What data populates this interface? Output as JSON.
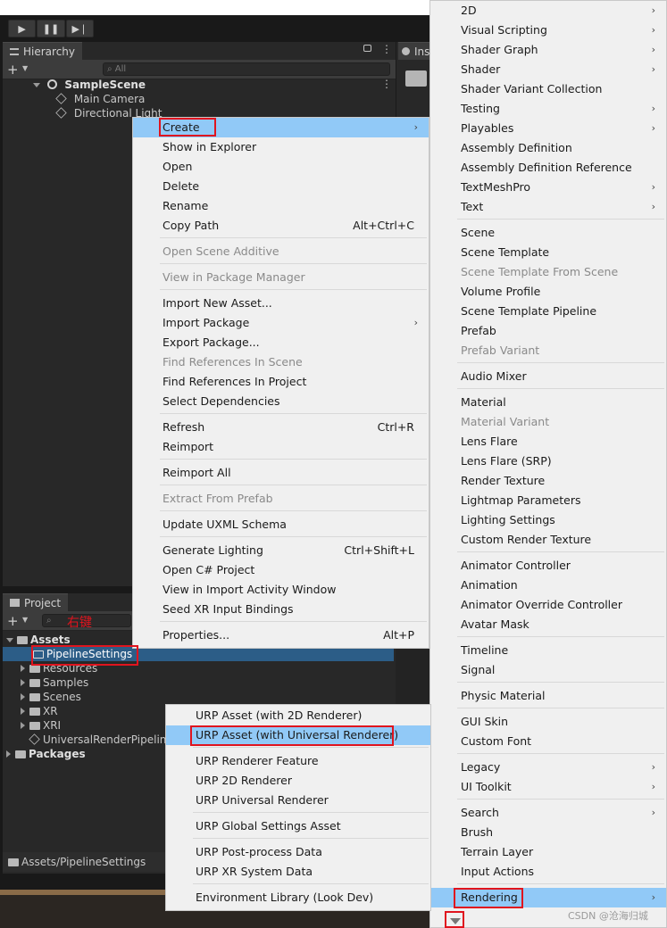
{
  "hierarchy": {
    "tab_label": "Hierarchy",
    "search_placeholder": "All",
    "plus": "+",
    "scene": "SampleScene",
    "objects": [
      "Main Camera",
      "Directional Light"
    ]
  },
  "inspector": {
    "tab_label": "Ins"
  },
  "project": {
    "tab_label": "Project",
    "plus": "+",
    "annotation": "右键",
    "tree": [
      {
        "label": "Assets",
        "level": 0,
        "bold": true,
        "expanded": true
      },
      {
        "label": "PipelineSettings",
        "level": 1,
        "selected": true
      },
      {
        "label": "Resources",
        "level": 1
      },
      {
        "label": "Samples",
        "level": 1
      },
      {
        "label": "Scenes",
        "level": 1
      },
      {
        "label": "XR",
        "level": 1
      },
      {
        "label": "XRI",
        "level": 1
      },
      {
        "label": "UniversalRenderPipelin",
        "level": 1,
        "asset": true
      },
      {
        "label": "Packages",
        "level": 0,
        "bold": true
      }
    ],
    "footer_path": "Assets/PipelineSettings"
  },
  "context_menu": {
    "groups": [
      [
        {
          "label": "Create",
          "submenu": true,
          "highlighted": true
        },
        {
          "label": "Show in Explorer"
        },
        {
          "label": "Open"
        },
        {
          "label": "Delete"
        },
        {
          "label": "Rename"
        },
        {
          "label": "Copy Path",
          "shortcut": "Alt+Ctrl+C"
        }
      ],
      [
        {
          "label": "Open Scene Additive",
          "disabled": true
        }
      ],
      [
        {
          "label": "View in Package Manager",
          "disabled": true
        }
      ],
      [
        {
          "label": "Import New Asset..."
        },
        {
          "label": "Import Package",
          "submenu": true
        },
        {
          "label": "Export Package..."
        },
        {
          "label": "Find References In Scene",
          "disabled": true
        },
        {
          "label": "Find References In Project"
        },
        {
          "label": "Select Dependencies"
        }
      ],
      [
        {
          "label": "Refresh",
          "shortcut": "Ctrl+R"
        },
        {
          "label": "Reimport"
        }
      ],
      [
        {
          "label": "Reimport All"
        }
      ],
      [
        {
          "label": "Extract From Prefab",
          "disabled": true
        }
      ],
      [
        {
          "label": "Update UXML Schema"
        }
      ],
      [
        {
          "label": "Generate Lighting",
          "shortcut": "Ctrl+Shift+L"
        },
        {
          "label": "Open C# Project"
        },
        {
          "label": "View in Import Activity Window"
        },
        {
          "label": "Seed XR Input Bindings"
        }
      ],
      [
        {
          "label": "Properties...",
          "shortcut": "Alt+P"
        }
      ]
    ]
  },
  "create_menu": {
    "groups": [
      [
        {
          "label": "2D",
          "submenu": true
        },
        {
          "label": "Visual Scripting",
          "submenu": true
        },
        {
          "label": "Shader Graph",
          "submenu": true
        },
        {
          "label": "Shader",
          "submenu": true
        },
        {
          "label": "Shader Variant Collection"
        },
        {
          "label": "Testing",
          "submenu": true
        },
        {
          "label": "Playables",
          "submenu": true
        },
        {
          "label": "Assembly Definition"
        },
        {
          "label": "Assembly Definition Reference"
        },
        {
          "label": "TextMeshPro",
          "submenu": true
        },
        {
          "label": "Text",
          "submenu": true
        }
      ],
      [
        {
          "label": "Scene"
        },
        {
          "label": "Scene Template"
        },
        {
          "label": "Scene Template From Scene",
          "disabled": true
        },
        {
          "label": "Volume Profile"
        },
        {
          "label": "Scene Template Pipeline"
        },
        {
          "label": "Prefab"
        },
        {
          "label": "Prefab Variant",
          "disabled": true
        }
      ],
      [
        {
          "label": "Audio Mixer"
        }
      ],
      [
        {
          "label": "Material"
        },
        {
          "label": "Material Variant",
          "disabled": true
        },
        {
          "label": "Lens Flare"
        },
        {
          "label": "Lens Flare (SRP)"
        },
        {
          "label": "Render Texture"
        },
        {
          "label": "Lightmap Parameters"
        },
        {
          "label": "Lighting Settings"
        },
        {
          "label": "Custom Render Texture"
        }
      ],
      [
        {
          "label": "Animator Controller"
        },
        {
          "label": "Animation"
        },
        {
          "label": "Animator Override Controller"
        },
        {
          "label": "Avatar Mask"
        }
      ],
      [
        {
          "label": "Timeline"
        },
        {
          "label": "Signal"
        }
      ],
      [
        {
          "label": "Physic Material"
        }
      ],
      [
        {
          "label": "GUI Skin"
        },
        {
          "label": "Custom Font"
        }
      ],
      [
        {
          "label": "Legacy",
          "submenu": true
        },
        {
          "label": "UI Toolkit",
          "submenu": true
        }
      ],
      [
        {
          "label": "Search",
          "submenu": true
        },
        {
          "label": "Brush"
        },
        {
          "label": "Terrain Layer"
        },
        {
          "label": "Input Actions"
        }
      ],
      [
        {
          "label": "Rendering",
          "submenu": true,
          "highlighted": true
        }
      ]
    ]
  },
  "rendering_menu": {
    "groups": [
      [
        {
          "label": "URP Asset (with 2D Renderer)"
        },
        {
          "label": "URP Asset (with Universal Renderer)",
          "highlighted": true
        }
      ],
      [
        {
          "label": "URP Renderer Feature"
        },
        {
          "label": "URP 2D Renderer"
        },
        {
          "label": "URP Universal Renderer"
        }
      ],
      [
        {
          "label": "URP Global Settings Asset"
        }
      ],
      [
        {
          "label": "URP Post-process Data"
        },
        {
          "label": "URP XR System Data"
        }
      ],
      [
        {
          "label": "Environment Library (Look Dev)"
        }
      ]
    ]
  },
  "watermark": "CSDN @沧海归城",
  "icons": {
    "submenu_arrow": "›",
    "play": "▶",
    "pause": "❚❚",
    "step": "▶❘"
  }
}
